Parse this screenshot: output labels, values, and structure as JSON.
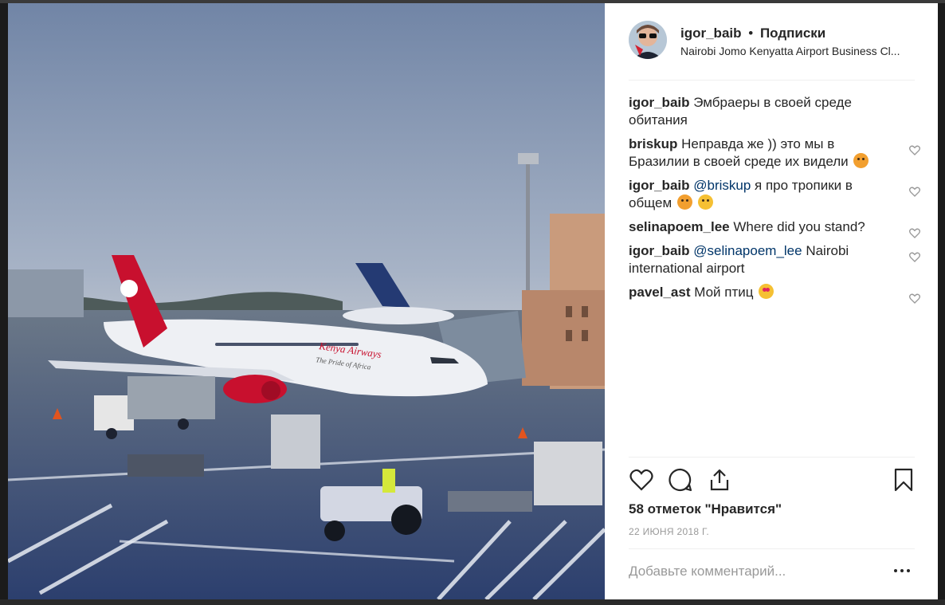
{
  "post": {
    "username": "igor_baib",
    "separator": "•",
    "follow_label": "Подписки",
    "location": "Nairobi Jomo Kenyatta Airport Business Cl..."
  },
  "comments": [
    {
      "author": "igor_baib",
      "text": "Эмбраеры в своей среде обитания"
    },
    {
      "author": "briskup",
      "text": "Неправда же )) это мы в Бразилии в своей среде их видели",
      "emoji": "squinting-tongue-emoji"
    },
    {
      "author": "igor_baib",
      "mention": "@briskup",
      "text": " я про тропики в общем",
      "emoji": "grimacing-emoji"
    },
    {
      "author": "selinapoem_lee",
      "text": "Where did you stand?"
    },
    {
      "author": "igor_baib",
      "mention": "@selinapoem_lee",
      "text": " Nairobi international airport"
    },
    {
      "author": "pavel_ast",
      "text": "Мой птиц",
      "emoji": "heart-eyes-emoji"
    }
  ],
  "likes_text": "58 отметок \"Нравится\"",
  "date_text": "22 ИЮНЯ 2018 Г.",
  "add_comment_placeholder": "Добавьте комментарий...",
  "photo": {
    "livery_text": "Kenya Airways",
    "tagline": "The Pride of Africa"
  },
  "icons": {
    "like": "heart-outline-icon",
    "comment": "speech-bubble-icon",
    "share": "share-upload-icon",
    "save": "bookmark-icon",
    "more": "more-options-icon",
    "comment_like": "small-heart-icon"
  },
  "colors": {
    "text": "#262626",
    "mention": "#003569",
    "secondary": "#999999",
    "divider": "#efefef",
    "livery_red": "#c8102e"
  }
}
